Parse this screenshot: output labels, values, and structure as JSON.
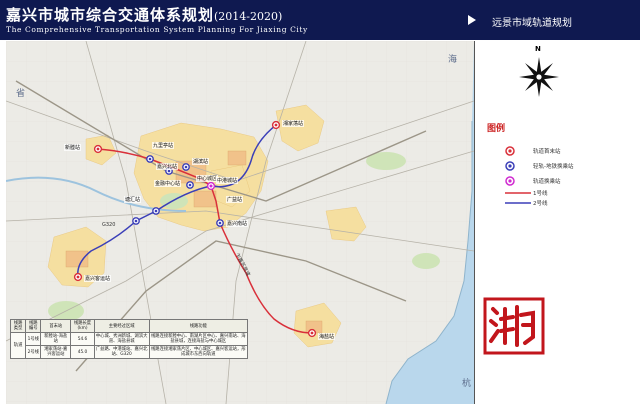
{
  "header": {
    "title": "嘉兴市城市综合交通体系规划",
    "years": "(2014-2020)",
    "title_en": "The Comprehensive Transportation System Planning For Jiaxing City",
    "subtitle": "远景市域轨道规划"
  },
  "compass": {
    "north_label": "N"
  },
  "legend": {
    "title": "图例",
    "items": [
      {
        "label": "轨道首末站",
        "symbol": "red-circle-marker"
      },
      {
        "label": "轻轨-地铁换乘站",
        "symbol": "blue-circle-marker"
      },
      {
        "label": "轨道换乘站",
        "symbol": "magenta-circle-marker"
      },
      {
        "label": "1号线",
        "symbol": "red-line"
      },
      {
        "label": "2号线",
        "symbol": "blue-line"
      }
    ]
  },
  "map": {
    "stations": [
      {
        "name": "新塍站",
        "kind": "terminal"
      },
      {
        "name": "九里亭站",
        "kind": "interchange"
      },
      {
        "name": "湘家荡站",
        "kind": "terminal"
      },
      {
        "name": "湖滨站",
        "kind": "interchange"
      },
      {
        "name": "嘉兴北站",
        "kind": "interchange"
      },
      {
        "name": "中心城区",
        "kind": "interchange"
      },
      {
        "name": "金融中心站",
        "kind": "interchange"
      },
      {
        "name": "中港城站",
        "kind": "transfer"
      },
      {
        "name": "广益站",
        "kind": "interchange"
      },
      {
        "name": "嘉兴南站",
        "kind": "interchange"
      },
      {
        "name": "塘汇站",
        "kind": "interchange"
      },
      {
        "name": "嘉兴客运站",
        "kind": "terminal"
      },
      {
        "name": "海盐站",
        "kind": "terminal"
      }
    ],
    "place_labels": [
      "省",
      "海",
      "杭"
    ],
    "road_labels": [
      "G320",
      "乍嘉苏高速"
    ]
  },
  "table": {
    "headers": [
      "线路类型",
      "线路编号",
      "首末站",
      "线路长度(km)",
      "主要经过区域",
      "线路功能"
    ],
    "rows": [
      {
        "type": "轨道",
        "line": "1号线",
        "stops": "新塍站-海盐站",
        "length": "54.6",
        "areas": "中心城、秀洲新城、湖滨大道、海盐县城",
        "function": "线路连接新塍中心、南湖片区中心、嘉兴南站、海盐县城，连接海盐与中心城区"
      },
      {
        "type": "",
        "line": "2号线",
        "stops": "湘家荡站-嘉兴客运站",
        "length": "45.0",
        "areas": "广益路、中港城站、嘉兴北站、G320",
        "function": "线路连接湘家荡片区、中心城区、嘉兴客运站，形成城市东西向轨道"
      }
    ]
  },
  "colors": {
    "header_bg": "#0f1950",
    "line1": "#d9303a",
    "line2": "#3b3fb8",
    "sea": "#b9d7ec",
    "land": "#ecebe6",
    "urban": "#f5dfa0"
  }
}
